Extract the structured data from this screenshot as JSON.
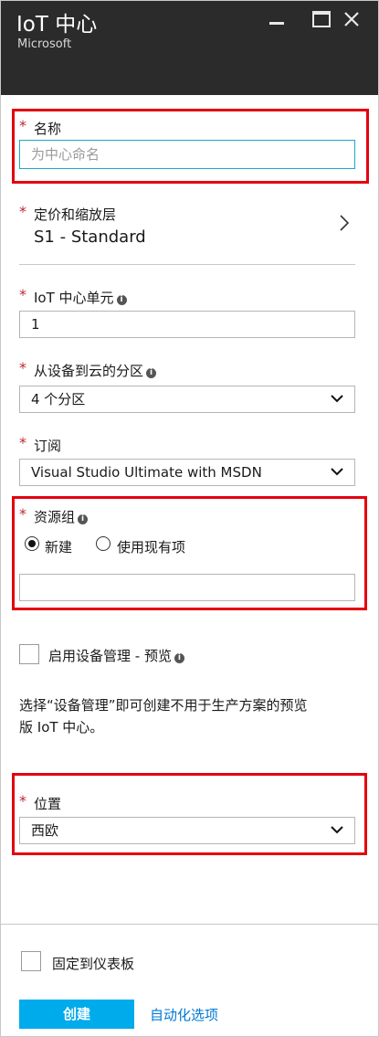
{
  "header": {
    "title": "IoT 中心",
    "subtitle": "Microsoft"
  },
  "form": {
    "name": {
      "label": "名称",
      "placeholder": "为中心命名",
      "value": ""
    },
    "pricing": {
      "label": "定价和缩放层",
      "value": "S1 - Standard"
    },
    "units": {
      "label": "IoT 中心单元",
      "value": "1"
    },
    "partitions": {
      "label": "从设备到云的分区",
      "value": "4 个分区"
    },
    "subscription": {
      "label": "订阅",
      "value": "Visual Studio Ultimate with MSDN"
    },
    "resource_group": {
      "label": "资源组",
      "option_new": "新建",
      "option_existing": "使用现有项",
      "selected": "新建",
      "value": ""
    },
    "device_mgmt": {
      "label": "启用设备管理 - 预览",
      "checked": false,
      "description_line1": "选择“设备管理”即可创建不用于生产方案的预览",
      "description_line2": "版 IoT 中心。"
    },
    "location": {
      "label": "位置",
      "value": "西欧"
    }
  },
  "footer": {
    "pin_label": "固定到仪表板",
    "pin_checked": false,
    "create_label": "创建",
    "automation_label": "自动化选项"
  },
  "colors": {
    "header_bg": "#2b2b2b",
    "highlight": "#e3000f",
    "required": "#c0282e",
    "primary": "#00abec",
    "link": "#0078d4",
    "focus": "#1fa7c9"
  }
}
